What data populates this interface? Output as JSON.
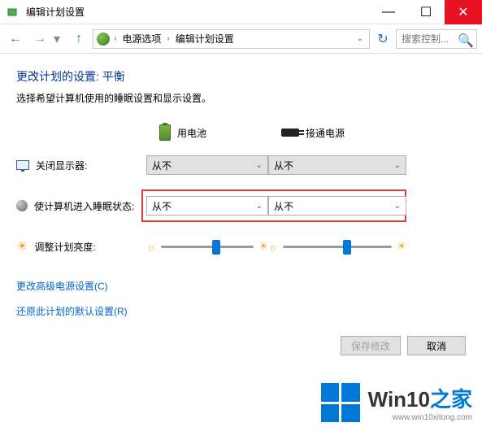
{
  "window": {
    "title": "编辑计划设置",
    "minimize": "—",
    "maximize": "☐",
    "close": "✕"
  },
  "nav": {
    "back": "←",
    "forward": "→",
    "dropdown": "▾",
    "up": "↑",
    "refresh": "↻",
    "breadcrumb": {
      "item1": "电源选项",
      "item2": "编辑计划设置"
    },
    "search_placeholder": "搜索控制..."
  },
  "page": {
    "heading": "更改计划的设置: 平衡",
    "subheading": "选择希望计算机使用的睡眠设置和显示设置。"
  },
  "columns": {
    "battery": "用电池",
    "plugged": "接通电源"
  },
  "rows": {
    "display_off": {
      "label": "关闭显示器:",
      "battery_value": "从不",
      "plugged_value": "从不"
    },
    "sleep": {
      "label": "使计算机进入睡眠状态:",
      "battery_value": "从不",
      "plugged_value": "从不"
    },
    "brightness": {
      "label": "调整计划亮度:"
    }
  },
  "links": {
    "advanced": "更改高级电源设置(C)",
    "restore": "还原此计划的默认设置(R)"
  },
  "buttons": {
    "save": "保存修改",
    "cancel": "取消"
  },
  "watermark": {
    "text_main": "Win10",
    "text_suffix": "之家",
    "sub": "www.win10xitong.com"
  }
}
